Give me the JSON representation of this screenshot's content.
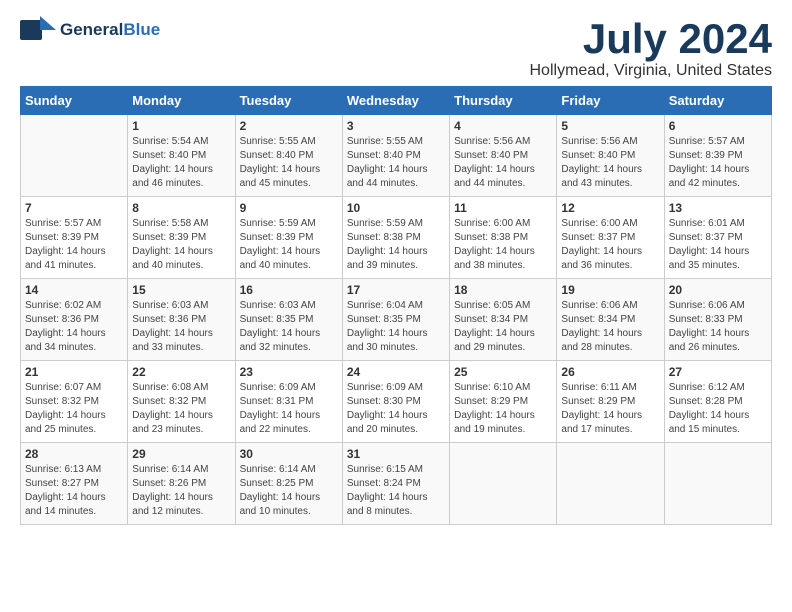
{
  "header": {
    "logo_general": "General",
    "logo_blue": "Blue",
    "title": "July 2024",
    "location": "Hollymead, Virginia, United States"
  },
  "days_of_week": [
    "Sunday",
    "Monday",
    "Tuesday",
    "Wednesday",
    "Thursday",
    "Friday",
    "Saturday"
  ],
  "weeks": [
    [
      {
        "day": "",
        "sunrise": "",
        "sunset": "",
        "daylight": ""
      },
      {
        "day": "1",
        "sunrise": "Sunrise: 5:54 AM",
        "sunset": "Sunset: 8:40 PM",
        "daylight": "Daylight: 14 hours and 46 minutes."
      },
      {
        "day": "2",
        "sunrise": "Sunrise: 5:55 AM",
        "sunset": "Sunset: 8:40 PM",
        "daylight": "Daylight: 14 hours and 45 minutes."
      },
      {
        "day": "3",
        "sunrise": "Sunrise: 5:55 AM",
        "sunset": "Sunset: 8:40 PM",
        "daylight": "Daylight: 14 hours and 44 minutes."
      },
      {
        "day": "4",
        "sunrise": "Sunrise: 5:56 AM",
        "sunset": "Sunset: 8:40 PM",
        "daylight": "Daylight: 14 hours and 44 minutes."
      },
      {
        "day": "5",
        "sunrise": "Sunrise: 5:56 AM",
        "sunset": "Sunset: 8:40 PM",
        "daylight": "Daylight: 14 hours and 43 minutes."
      },
      {
        "day": "6",
        "sunrise": "Sunrise: 5:57 AM",
        "sunset": "Sunset: 8:39 PM",
        "daylight": "Daylight: 14 hours and 42 minutes."
      }
    ],
    [
      {
        "day": "7",
        "sunrise": "Sunrise: 5:57 AM",
        "sunset": "Sunset: 8:39 PM",
        "daylight": "Daylight: 14 hours and 41 minutes."
      },
      {
        "day": "8",
        "sunrise": "Sunrise: 5:58 AM",
        "sunset": "Sunset: 8:39 PM",
        "daylight": "Daylight: 14 hours and 40 minutes."
      },
      {
        "day": "9",
        "sunrise": "Sunrise: 5:59 AM",
        "sunset": "Sunset: 8:39 PM",
        "daylight": "Daylight: 14 hours and 40 minutes."
      },
      {
        "day": "10",
        "sunrise": "Sunrise: 5:59 AM",
        "sunset": "Sunset: 8:38 PM",
        "daylight": "Daylight: 14 hours and 39 minutes."
      },
      {
        "day": "11",
        "sunrise": "Sunrise: 6:00 AM",
        "sunset": "Sunset: 8:38 PM",
        "daylight": "Daylight: 14 hours and 38 minutes."
      },
      {
        "day": "12",
        "sunrise": "Sunrise: 6:00 AM",
        "sunset": "Sunset: 8:37 PM",
        "daylight": "Daylight: 14 hours and 36 minutes."
      },
      {
        "day": "13",
        "sunrise": "Sunrise: 6:01 AM",
        "sunset": "Sunset: 8:37 PM",
        "daylight": "Daylight: 14 hours and 35 minutes."
      }
    ],
    [
      {
        "day": "14",
        "sunrise": "Sunrise: 6:02 AM",
        "sunset": "Sunset: 8:36 PM",
        "daylight": "Daylight: 14 hours and 34 minutes."
      },
      {
        "day": "15",
        "sunrise": "Sunrise: 6:03 AM",
        "sunset": "Sunset: 8:36 PM",
        "daylight": "Daylight: 14 hours and 33 minutes."
      },
      {
        "day": "16",
        "sunrise": "Sunrise: 6:03 AM",
        "sunset": "Sunset: 8:35 PM",
        "daylight": "Daylight: 14 hours and 32 minutes."
      },
      {
        "day": "17",
        "sunrise": "Sunrise: 6:04 AM",
        "sunset": "Sunset: 8:35 PM",
        "daylight": "Daylight: 14 hours and 30 minutes."
      },
      {
        "day": "18",
        "sunrise": "Sunrise: 6:05 AM",
        "sunset": "Sunset: 8:34 PM",
        "daylight": "Daylight: 14 hours and 29 minutes."
      },
      {
        "day": "19",
        "sunrise": "Sunrise: 6:06 AM",
        "sunset": "Sunset: 8:34 PM",
        "daylight": "Daylight: 14 hours and 28 minutes."
      },
      {
        "day": "20",
        "sunrise": "Sunrise: 6:06 AM",
        "sunset": "Sunset: 8:33 PM",
        "daylight": "Daylight: 14 hours and 26 minutes."
      }
    ],
    [
      {
        "day": "21",
        "sunrise": "Sunrise: 6:07 AM",
        "sunset": "Sunset: 8:32 PM",
        "daylight": "Daylight: 14 hours and 25 minutes."
      },
      {
        "day": "22",
        "sunrise": "Sunrise: 6:08 AM",
        "sunset": "Sunset: 8:32 PM",
        "daylight": "Daylight: 14 hours and 23 minutes."
      },
      {
        "day": "23",
        "sunrise": "Sunrise: 6:09 AM",
        "sunset": "Sunset: 8:31 PM",
        "daylight": "Daylight: 14 hours and 22 minutes."
      },
      {
        "day": "24",
        "sunrise": "Sunrise: 6:09 AM",
        "sunset": "Sunset: 8:30 PM",
        "daylight": "Daylight: 14 hours and 20 minutes."
      },
      {
        "day": "25",
        "sunrise": "Sunrise: 6:10 AM",
        "sunset": "Sunset: 8:29 PM",
        "daylight": "Daylight: 14 hours and 19 minutes."
      },
      {
        "day": "26",
        "sunrise": "Sunrise: 6:11 AM",
        "sunset": "Sunset: 8:29 PM",
        "daylight": "Daylight: 14 hours and 17 minutes."
      },
      {
        "day": "27",
        "sunrise": "Sunrise: 6:12 AM",
        "sunset": "Sunset: 8:28 PM",
        "daylight": "Daylight: 14 hours and 15 minutes."
      }
    ],
    [
      {
        "day": "28",
        "sunrise": "Sunrise: 6:13 AM",
        "sunset": "Sunset: 8:27 PM",
        "daylight": "Daylight: 14 hours and 14 minutes."
      },
      {
        "day": "29",
        "sunrise": "Sunrise: 6:14 AM",
        "sunset": "Sunset: 8:26 PM",
        "daylight": "Daylight: 14 hours and 12 minutes."
      },
      {
        "day": "30",
        "sunrise": "Sunrise: 6:14 AM",
        "sunset": "Sunset: 8:25 PM",
        "daylight": "Daylight: 14 hours and 10 minutes."
      },
      {
        "day": "31",
        "sunrise": "Sunrise: 6:15 AM",
        "sunset": "Sunset: 8:24 PM",
        "daylight": "Daylight: 14 hours and 8 minutes."
      },
      {
        "day": "",
        "sunrise": "",
        "sunset": "",
        "daylight": ""
      },
      {
        "day": "",
        "sunrise": "",
        "sunset": "",
        "daylight": ""
      },
      {
        "day": "",
        "sunrise": "",
        "sunset": "",
        "daylight": ""
      }
    ]
  ]
}
